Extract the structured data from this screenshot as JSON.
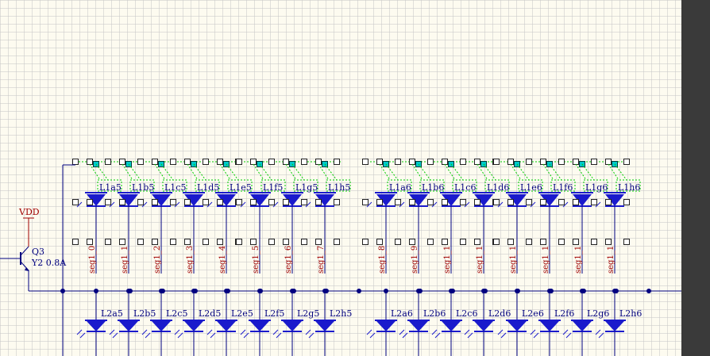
{
  "power_label": "VDD",
  "transistor": {
    "designator": "Q3",
    "value": "Y2 0.8A"
  },
  "top_leds": [
    "L1a5",
    "L1b5",
    "L1c5",
    "L1d5",
    "L1e5",
    "L1f5",
    "L1g5",
    "L1h5",
    "L1a6",
    "L1b6",
    "L1c6",
    "L1d6",
    "L1e6",
    "L1f6",
    "L1g6",
    "L1h6"
  ],
  "bottom_leds": [
    "L2a5",
    "L2b5",
    "L2c5",
    "L2d5",
    "L2e5",
    "L2f5",
    "L2g5",
    "L2h5",
    "L2a6",
    "L2b6",
    "L2c6",
    "L2d6",
    "L2e6",
    "L2f6",
    "L2g6",
    "L2h6"
  ],
  "net_labels": [
    "seg1_0",
    "seg1_1",
    "seg1_2",
    "seg1_3",
    "seg1_4",
    "seg1_5",
    "seg1_6",
    "seg1_7",
    "seg1_8",
    "seg1_9",
    "seg1_1",
    "seg1_1",
    "seg1_1",
    "seg1_1",
    "seg1_1",
    "seg1_1"
  ],
  "colors": {
    "wire": "#00007f",
    "led": "#1a1acc",
    "net": "#a00000",
    "selection": "#00cc00",
    "handle": "#00c8c8",
    "grid": "#c8c8c8"
  }
}
